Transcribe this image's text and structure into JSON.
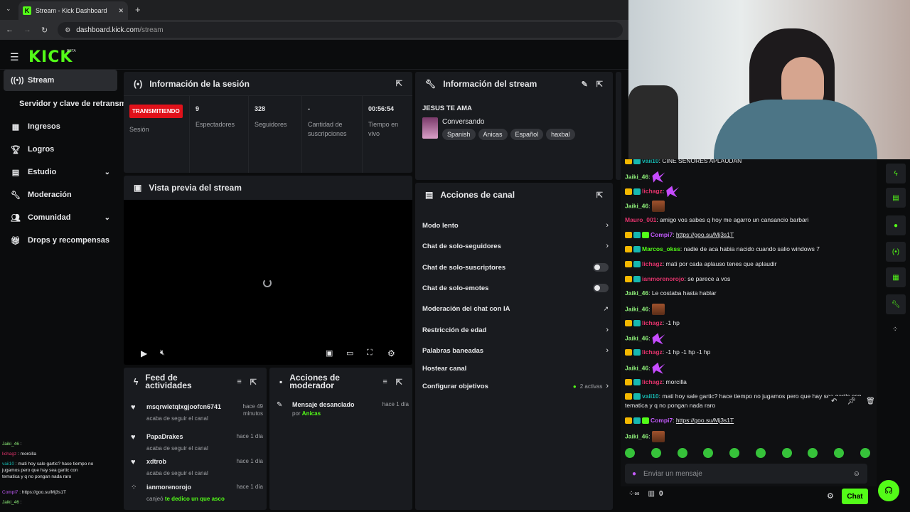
{
  "browser": {
    "tab_title": "Stream - Kick Dashboard",
    "url_host": "dashboard.kick.com",
    "url_path": "/stream"
  },
  "header": {
    "logo": "KICK",
    "beta": "BETA"
  },
  "sidebar": {
    "items": [
      {
        "label": "Stream",
        "icon": "broadcast-icon"
      },
      {
        "label": "Servidor y clave de retransm",
        "icon": ""
      },
      {
        "label": "Ingresos",
        "icon": "chart-icon"
      },
      {
        "label": "Logros",
        "icon": "trophy-icon"
      },
      {
        "label": "Estudio",
        "icon": "studio-icon"
      },
      {
        "label": "Moderación",
        "icon": "wrench-icon"
      },
      {
        "label": "Comunidad",
        "icon": "community-icon"
      },
      {
        "label": "Drops y recompensas",
        "icon": "gift-icon"
      }
    ]
  },
  "session": {
    "title": "Información de la sesión",
    "status_badge": "TRANSMITIENDO",
    "status_label": "Sesión",
    "viewers_value": "9",
    "viewers_label": "Espectadores",
    "followers_value": "328",
    "followers_label": "Seguidores",
    "subs_value": "-",
    "subs_label": "Cantidad de suscripciones",
    "uptime_value": "00:56:54",
    "uptime_label": "Tiempo en vivo"
  },
  "stream_info": {
    "title": "Información del stream",
    "stream_title": "JESUS TE AMA",
    "category": "Conversando",
    "tags": [
      "Spanish",
      "Anicas",
      "Español",
      "haxbal"
    ]
  },
  "preview": {
    "title": "Vista previa del stream"
  },
  "channel_actions": {
    "title": "Acciones de canal",
    "items": [
      {
        "label": "Modo lento",
        "right": "chevron"
      },
      {
        "label": "Chat de solo-seguidores",
        "right": "chevron"
      },
      {
        "label": "Chat de solo-suscriptores",
        "right": "toggle"
      },
      {
        "label": "Chat de solo-emotes",
        "right": "toggle"
      },
      {
        "label": "Moderación del chat con IA",
        "right": "external"
      },
      {
        "label": "Restricción de edad",
        "right": "chevron"
      },
      {
        "label": "Palabras baneadas",
        "right": "chevron"
      },
      {
        "label": "Hostear canal",
        "right": ""
      },
      {
        "label": "Configurar objetivos",
        "right": "chevron",
        "note": "2 activas"
      }
    ]
  },
  "activity_feed": {
    "title": "Feed de actividades",
    "items": [
      {
        "name": "msqrwletqlxgjoofcn6741",
        "sub": "acaba de seguir el canal",
        "time": "hace 49 minutos"
      },
      {
        "name": "PapaDrakes",
        "sub": "acaba de seguir el canal",
        "time": "hace 1 día"
      },
      {
        "name": "xdtrob",
        "sub": "acaba de seguir el canal",
        "time": "hace 1 día"
      },
      {
        "name": "ianmorenorojo",
        "sub": "canjeó",
        "reward": "te dedico un que asco",
        "time": "hace 1 día"
      }
    ]
  },
  "mod_actions": {
    "title": "Acciones de moderador",
    "items": [
      {
        "action": "Mensaje desanclado",
        "by_label": "por",
        "by": "Anicas",
        "time": "hace 1 día"
      }
    ]
  },
  "chat": {
    "messages": [
      {
        "user": "vaii10",
        "color": "#16b8b0",
        "text": ": CINE SEÑORES APLAUDAN",
        "badges": [
          "b1",
          "b2"
        ]
      },
      {
        "user": "Jaiki_46",
        "color": "#8ff07a",
        "text": ":",
        "emote": "but",
        "badges": []
      },
      {
        "user": "lichagz",
        "color": "#e0336b",
        "text": ":",
        "emote": "but",
        "badges": [
          "b1",
          "b2"
        ]
      },
      {
        "user": "Jaiki_46",
        "color": "#8ff07a",
        "text": ":",
        "emote": "face",
        "badges": []
      },
      {
        "user": "Mauro_001",
        "color": "#e0336b",
        "text": ": amigo vos sabes q hoy me agarro un cansancio barbari",
        "badges": []
      },
      {
        "user": "Compi7",
        "color": "#c55bff",
        "text": ": ",
        "link": "https://goo.su/Mj3s1T",
        "badges": [
          "b1",
          "b2",
          "b3"
        ]
      },
      {
        "user": "Marcos_okss",
        "color": "#53fc18",
        "text": ": nadie de aca habia nacido cuando salio windows 7",
        "badges": [
          "b1",
          "b2"
        ]
      },
      {
        "user": "lichagz",
        "color": "#e0336b",
        "text": ": mati por cada aplauso tenes que aplaudir",
        "badges": [
          "b1",
          "b2"
        ]
      },
      {
        "user": "ianmorenorojo",
        "color": "#e0336b",
        "text": ": se parece a vos",
        "badges": [
          "b1",
          "b2"
        ]
      },
      {
        "user": "Jaiki_46",
        "color": "#8ff07a",
        "text": ": Le costaba hasta hablar",
        "badges": []
      },
      {
        "user": "Jaiki_46",
        "color": "#8ff07a",
        "text": ":",
        "emote": "face",
        "badges": []
      },
      {
        "user": "lichagz",
        "color": "#e0336b",
        "text": ": -1 hp",
        "badges": [
          "b1",
          "b2"
        ]
      },
      {
        "user": "Jaiki_46",
        "color": "#8ff07a",
        "text": ":",
        "emote": "but",
        "badges": []
      },
      {
        "user": "lichagz",
        "color": "#e0336b",
        "text": ": -1 hp -1 hp -1 hp",
        "badges": [
          "b1",
          "b2"
        ]
      },
      {
        "user": "Jaiki_46",
        "color": "#8ff07a",
        "text": ":",
        "emote": "but",
        "badges": []
      },
      {
        "user": "lichagz",
        "color": "#e0336b",
        "text": ": morcilla",
        "badges": [
          "b1",
          "b2"
        ]
      },
      {
        "user": "vaii10",
        "color": "#16b8b0",
        "text": ": mati hoy sale gartic? hace tiempo no jugamos pero que hay sea gartic con tematica y q no pongan nada raro",
        "badges": [
          "b1",
          "b2"
        ]
      },
      {
        "user": "Compi7",
        "color": "#c55bff",
        "text": ": ",
        "link": "https://goo.su/Mj3s1T",
        "badges": [
          "b1",
          "b2",
          "b3"
        ]
      },
      {
        "user": "Jaiki_46",
        "color": "#8ff07a",
        "text": ":",
        "emote": "face",
        "badges": []
      }
    ],
    "input_placeholder": "Enviar un mensaje",
    "points": "0",
    "send_label": "Chat"
  },
  "overlay_chat": [
    {
      "user": "Jaiki_46",
      "text": " :",
      "color": "#8ff07a"
    },
    {
      "user": "lichagz",
      "text": " : morcilla",
      "color": "#e0336b"
    },
    {
      "user": "vaii10",
      "text": " : mati hoy sale gartic? hace tiempo no jugamos pero que hay sea gartic con tematica y q no pongan nada raro",
      "color": "#16b8b0"
    },
    {
      "user": "Compi7",
      "text": " : https://goo.su/Mj3s1T",
      "color": "#c55bff"
    },
    {
      "user": "Jaiki_46",
      "text": " :",
      "color": "#8ff07a"
    }
  ]
}
